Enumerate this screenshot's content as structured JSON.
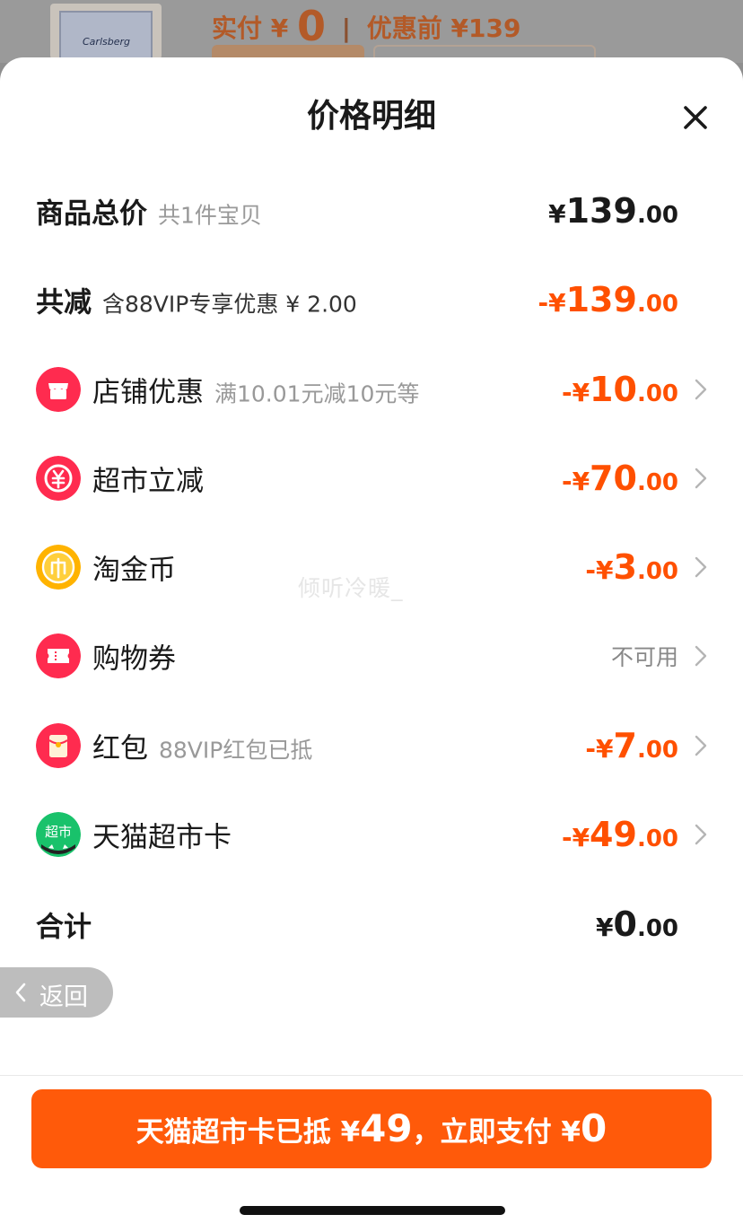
{
  "backdrop": {
    "paid_label": "实付",
    "paid_currency": "¥",
    "paid_value": "0",
    "before_label": "优惠前",
    "before_value": "¥139",
    "product_brand": "Carlsberg"
  },
  "sheet": {
    "title": "价格明细",
    "watermark": "倾听冷暖_"
  },
  "rows": {
    "total": {
      "label": "商品总价",
      "sub": "共1件宝贝",
      "amount": {
        "sign": "",
        "currency": "¥",
        "int": "139",
        "dec": ".00"
      }
    },
    "reduced": {
      "label": "共减",
      "sub": "含88VIP专享优惠 ¥ 2.00",
      "amount": {
        "sign": "-",
        "currency": "¥",
        "int": "139",
        "dec": ".00"
      }
    },
    "store_discount": {
      "label": "店铺优惠",
      "sub": "满10.01元减10元等",
      "amount": {
        "sign": "-",
        "currency": "¥",
        "int": "10",
        "dec": ".00"
      }
    },
    "supermarket_cut": {
      "label": "超市立减",
      "sub": "",
      "amount": {
        "sign": "-",
        "currency": "¥",
        "int": "70",
        "dec": ".00"
      }
    },
    "taojinbi": {
      "label": "淘金币",
      "sub": "",
      "amount": {
        "sign": "-",
        "currency": "¥",
        "int": "3",
        "dec": ".00"
      }
    },
    "coupon": {
      "label": "购物券",
      "status": "不可用"
    },
    "red_packet": {
      "label": "红包",
      "sub": "88VIP红包已抵",
      "amount": {
        "sign": "-",
        "currency": "¥",
        "int": "7",
        "dec": ".00"
      }
    },
    "tmall_card": {
      "label": "天猫超市卡",
      "sub": "",
      "icon_text": "超市",
      "amount": {
        "sign": "-",
        "currency": "¥",
        "int": "49",
        "dec": ".00"
      }
    },
    "sum": {
      "label": "合计",
      "amount": {
        "sign": "",
        "currency": "¥",
        "int": "0",
        "dec": ".00"
      }
    }
  },
  "back_pill": {
    "label": "返回"
  },
  "pay_button": {
    "prefix": "天猫超市卡已抵",
    "currency1": "¥",
    "deducted": "49",
    "middle": "，立即支付",
    "currency2": "¥",
    "pay": "0"
  },
  "icons": {
    "store": "store-icon",
    "supermarket": "yuan-circle-icon",
    "coin": "coin-icon",
    "coupon": "ticket-icon",
    "red_packet": "red-envelope-icon",
    "tmall_card": "tmall-supermarket-icon"
  },
  "colors": {
    "accent": "#ff5000",
    "button": "#ff5a0a",
    "icon_red": "#ff2b4f",
    "icon_gold": "#ffb300",
    "icon_green": "#19c26b"
  }
}
